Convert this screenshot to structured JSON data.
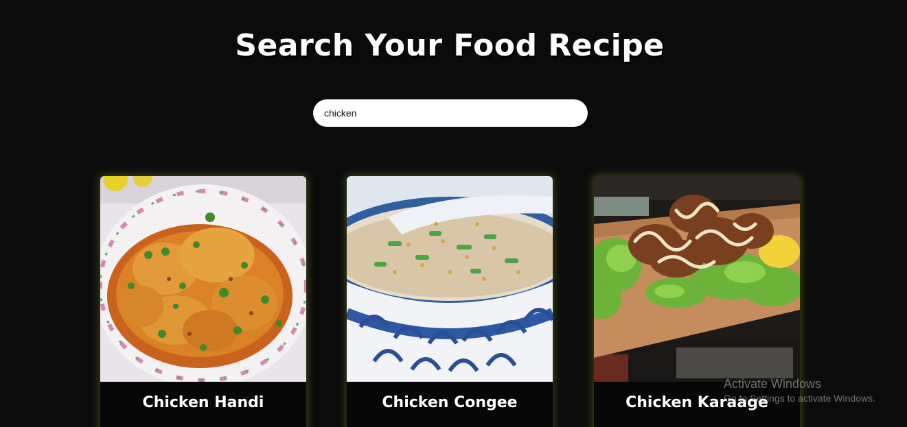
{
  "header": {
    "title": "Search Your Food Recipe"
  },
  "search": {
    "value": "chicken",
    "placeholder": ""
  },
  "results": [
    {
      "name": "Chicken Handi",
      "image_icon": "curry-bowl-image"
    },
    {
      "name": "Chicken Congee",
      "image_icon": "congee-bowl-image"
    },
    {
      "name": "Chicken Karaage",
      "image_icon": "karaage-board-image"
    }
  ],
  "watermark": {
    "title": "Activate Windows",
    "subtitle": "Go to Settings to activate Windows."
  },
  "colors": {
    "background": "#0b0b0b",
    "card_glow": "#788c28",
    "text": "#ffffff"
  }
}
